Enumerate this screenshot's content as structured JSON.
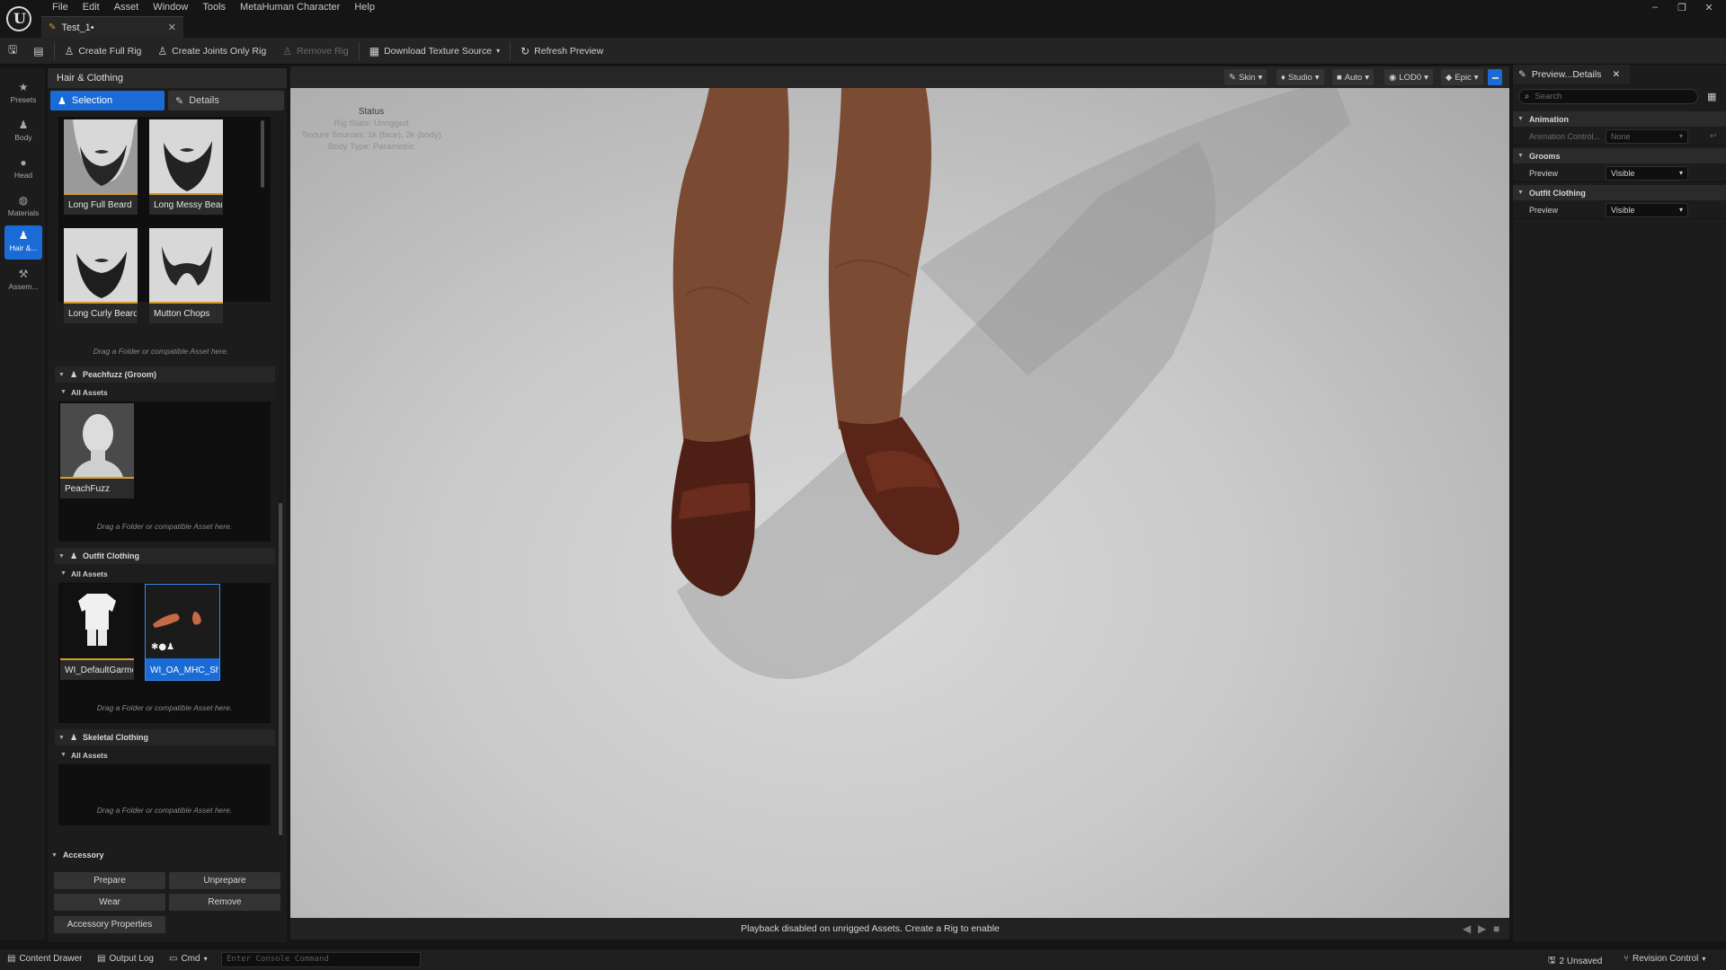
{
  "app": {
    "menu": [
      "File",
      "Edit",
      "Asset",
      "Window",
      "Tools",
      "MetaHuman Character",
      "Help"
    ],
    "document_tab": "Test_1•",
    "window_controls": [
      "–",
      "❐",
      "✕"
    ]
  },
  "toolbar": {
    "create_full_rig": "Create Full Rig",
    "create_joints_only_rig": "Create Joints Only Rig",
    "remove_rig": "Remove Rig",
    "download_texture_source": "Download Texture Source",
    "refresh_preview": "Refresh Preview"
  },
  "rail": {
    "items": [
      {
        "label": "Presets",
        "icon": "star-icon"
      },
      {
        "label": "Body",
        "icon": "body-icon"
      },
      {
        "label": "Head",
        "icon": "head-icon"
      },
      {
        "label": "Materials",
        "icon": "materials-icon"
      },
      {
        "label": "Hair &...",
        "icon": "hair-icon",
        "active": true
      },
      {
        "label": "Assem...",
        "icon": "assembly-icon"
      }
    ]
  },
  "left_panel": {
    "title": "Hair & Clothing",
    "tabs": {
      "selection": "Selection",
      "details": "Details"
    },
    "beards": [
      "Long Full Beard",
      "Long Messy Beard",
      "Long Curly Beard",
      "Mutton Chops"
    ],
    "drag_hint": "Drag a Folder or compatible Asset here.",
    "sections": {
      "peachfuzz": {
        "title": "Peachfuzz (Groom)",
        "sub": "All Assets",
        "items": [
          "PeachFuzz"
        ]
      },
      "outfit": {
        "title": "Outfit Clothing",
        "sub": "All Assets",
        "items": [
          "WI_DefaultGarment",
          "WI_OA_MHC_Sho..."
        ]
      },
      "skeletal": {
        "title": "Skeletal Clothing",
        "sub": "All Assets"
      }
    }
  },
  "accessory": {
    "title": "Accessory",
    "prepare": "Prepare",
    "unprepare": "Unprepare",
    "wear": "Wear",
    "remove": "Remove",
    "properties": "Accessory Properties"
  },
  "viewport": {
    "options": [
      "Skin",
      "Studio",
      "Auto",
      "LOD0",
      "Epic"
    ],
    "status": {
      "title": "Status",
      "rig_state": "Rig State: Unrigged",
      "texture_sources": "Texture Sources: 1k (face), 2k (body)",
      "body_type": "Body Type: Parametric"
    },
    "playback_message": "Playback disabled on unrigged Assets. Create a Rig to enable"
  },
  "details": {
    "tab": "Preview...Details",
    "search_placeholder": "Search",
    "categories": [
      {
        "title": "Animation",
        "rows": [
          {
            "key": "Animation Control...",
            "value": "None",
            "dim": true
          }
        ]
      },
      {
        "title": "Grooms",
        "rows": [
          {
            "key": "Preview",
            "value": "Visible"
          }
        ]
      },
      {
        "title": "Outfit Clothing",
        "rows": [
          {
            "key": "Preview",
            "value": "Visible"
          }
        ]
      }
    ]
  },
  "statusbar": {
    "content_drawer": "Content Drawer",
    "output_log": "Output Log",
    "cmd": "Cmd",
    "console_placeholder": "Enter Console Command",
    "unsaved": "2 Unsaved",
    "revision_control": "Revision Control"
  },
  "colors": {
    "accent": "#1a6bd6",
    "thumb_bar": "#d69a2d",
    "skin": "#7a4a32",
    "shoe": "#5a2418"
  }
}
